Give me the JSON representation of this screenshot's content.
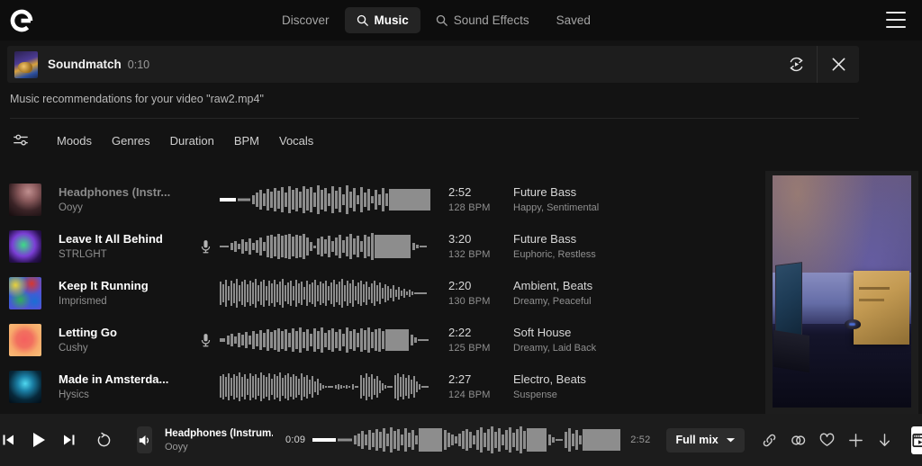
{
  "header": {
    "logo_icon": "epidemic-sound-logo",
    "nav": [
      {
        "label": "Discover",
        "icon": null,
        "active": false
      },
      {
        "label": "Music",
        "icon": "search-icon",
        "active": true
      },
      {
        "label": "Sound Effects",
        "icon": "search-icon",
        "active": false
      },
      {
        "label": "Saved",
        "icon": null,
        "active": false
      }
    ],
    "menu_icon": "hamburger-menu-icon"
  },
  "soundmatch": {
    "title": "Soundmatch",
    "time": "0:10",
    "replay_icon": "replay-video-icon",
    "close_icon": "close-icon"
  },
  "recommendation_text": "Music recommendations for your video \"raw2.mp4\"",
  "filters": {
    "icon": "filter-sliders-icon",
    "items": [
      "Moods",
      "Genres",
      "Duration",
      "BPM",
      "Vocals"
    ]
  },
  "tracks": [
    {
      "title": "Headphones (Instr...",
      "artist": "Ooyy",
      "duration": "2:52",
      "bpm": "128 BPM",
      "genre": "Future Bass",
      "moods": "Happy, Sentimental",
      "has_vocals": false,
      "is_playing": true,
      "art_colors": [
        "#2a1a1c",
        "#a9787a",
        "#6d4448",
        "#1a1012"
      ]
    },
    {
      "title": "Leave It All Behind",
      "artist": "STRLGHT",
      "duration": "3:20",
      "bpm": "132 BPM",
      "genre": "Future Bass",
      "moods": "Euphoric, Restless",
      "has_vocals": true,
      "is_playing": false,
      "art_colors": [
        "#1d0b3a",
        "#7b3fd6",
        "#35d17a",
        "#0d0520"
      ]
    },
    {
      "title": "Keep It Running",
      "artist": "Imprismed",
      "duration": "2:20",
      "bpm": "130 BPM",
      "genre": "Ambient, Beats",
      "moods": "Dreamy, Peaceful",
      "has_vocals": false,
      "is_playing": false,
      "art_colors": [
        "#1a6fd4",
        "#e8d23a",
        "#d8372f",
        "#2fae5c"
      ]
    },
    {
      "title": "Letting Go",
      "artist": "Cushy",
      "duration": "2:22",
      "bpm": "125 BPM",
      "genre": "Soft House",
      "moods": "Dreamy, Laid Back",
      "has_vocals": true,
      "is_playing": false,
      "art_colors": [
        "#f9b870",
        "#f4715f",
        "#ef5d63",
        "#f7a86a"
      ]
    },
    {
      "title": "Made in Amsterda...",
      "artist": "Hysics",
      "duration": "2:27",
      "bpm": "124 BPM",
      "genre": "Electro, Beats",
      "moods": "Suspense",
      "has_vocals": false,
      "is_playing": false,
      "art_colors": [
        "#06151e",
        "#1e94b8",
        "#35d6ee",
        "#041018"
      ]
    }
  ],
  "video_preview": {
    "description": "desk-with-laptop-and-cardboard-box"
  },
  "player": {
    "prev_icon": "previous-track-icon",
    "play_icon": "play-icon",
    "next_icon": "next-track-icon",
    "loop_icon": "loop-icon",
    "volume_icon": "volume-icon",
    "track_title": "Headphones (Instrum...",
    "track_artist": "Ooyy",
    "elapsed": "0:09",
    "total": "2:52",
    "progress_percent": 5,
    "mix": {
      "label": "Full mix",
      "chevron_icon": "chevron-down-icon"
    },
    "actions": [
      {
        "icon": "link-icon",
        "name": "copy-link-button"
      },
      {
        "icon": "stems-icon",
        "name": "stems-button"
      },
      {
        "icon": "heart-icon",
        "name": "favorite-button"
      },
      {
        "icon": "plus-icon",
        "name": "add-to-playlist-button"
      },
      {
        "icon": "download-icon",
        "name": "download-button"
      }
    ],
    "video_toggle_icon": "video-window-icon"
  }
}
